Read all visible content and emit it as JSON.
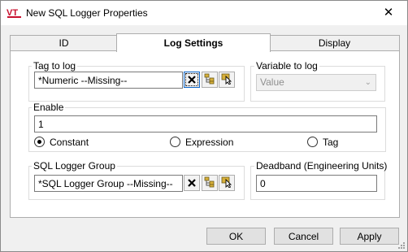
{
  "window": {
    "title": "New SQL Logger Properties",
    "close_glyph": "✕",
    "app_icon": "vt-scada-logo"
  },
  "tabs": [
    {
      "label": "ID",
      "active": false
    },
    {
      "label": "Log Settings",
      "active": true
    },
    {
      "label": "Display",
      "active": false
    }
  ],
  "tag_to_log": {
    "label": "Tag to log",
    "value": "*Numeric    --Missing--"
  },
  "variable_to_log": {
    "label": "Variable to log",
    "value": "Value",
    "enabled": false
  },
  "enable": {
    "label": "Enable",
    "value": "1",
    "options": [
      {
        "label": "Constant",
        "selected": true
      },
      {
        "label": "Expression",
        "selected": false
      },
      {
        "label": "Tag",
        "selected": false
      }
    ]
  },
  "sql_logger_group": {
    "label": "SQL Logger Group",
    "value": "*SQL Logger Group    --Missing--"
  },
  "deadband": {
    "label": "Deadband (Engineering Units)",
    "value": "0"
  },
  "buttons": {
    "ok": "OK",
    "cancel": "Cancel",
    "apply": "Apply"
  },
  "icons": {
    "clear": "clear-x-icon",
    "tag_browser": "tag-browser-icon",
    "select_pointer": "select-pointer-icon"
  },
  "colors": {
    "clear_focus_border": "#0a64c8",
    "icon_tree_yellow": "#d8b03a",
    "vt_logo_red": "#c8102e"
  }
}
